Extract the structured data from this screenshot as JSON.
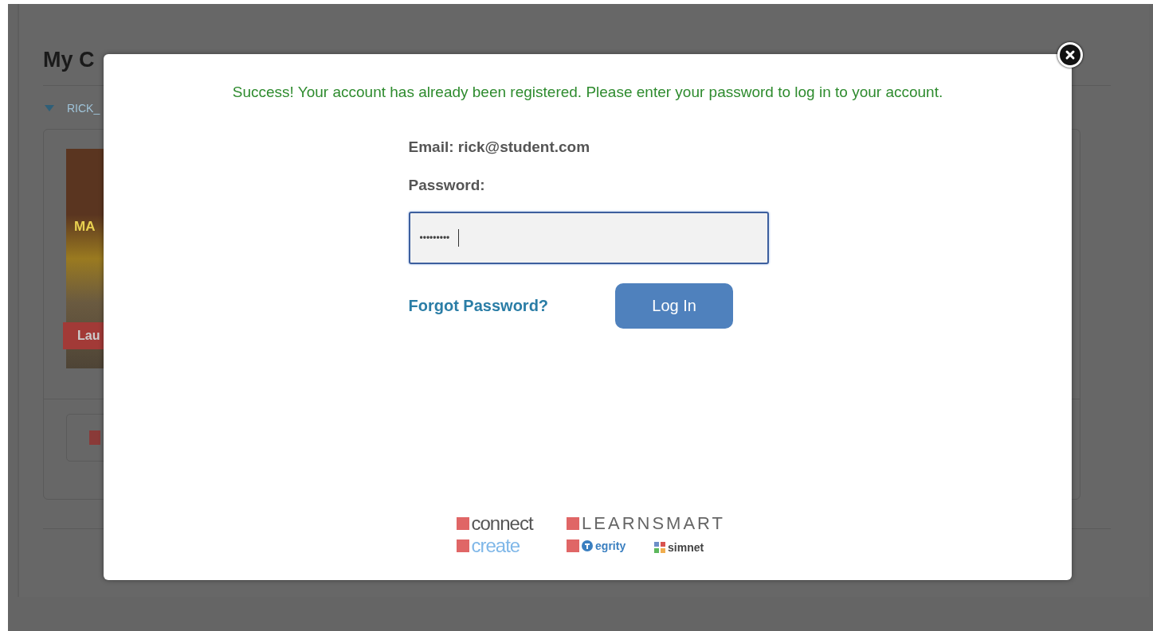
{
  "page": {
    "heading": "My C",
    "section_toggle": {
      "label": "RICK_",
      "expanded": true
    },
    "course_card": {
      "cover_title": "MA",
      "launch_button": "Lau"
    }
  },
  "modal": {
    "message": "Success! Your account has already been registered. Please enter your password to log in to your account.",
    "email_label": "Email: rick@student.com",
    "password_label": "Password:",
    "password_value": "•••••••••",
    "forgot_link": "Forgot Password?",
    "login_button": "Log In",
    "logos": [
      {
        "kind": "connect",
        "text": "connect"
      },
      {
        "kind": "learnsmart",
        "text": "LEARNSMART"
      },
      {
        "kind": "create",
        "text": "create"
      },
      {
        "kind": "tegrity",
        "text": "egrity"
      },
      {
        "kind": "simnet",
        "text": "simnet"
      }
    ]
  }
}
